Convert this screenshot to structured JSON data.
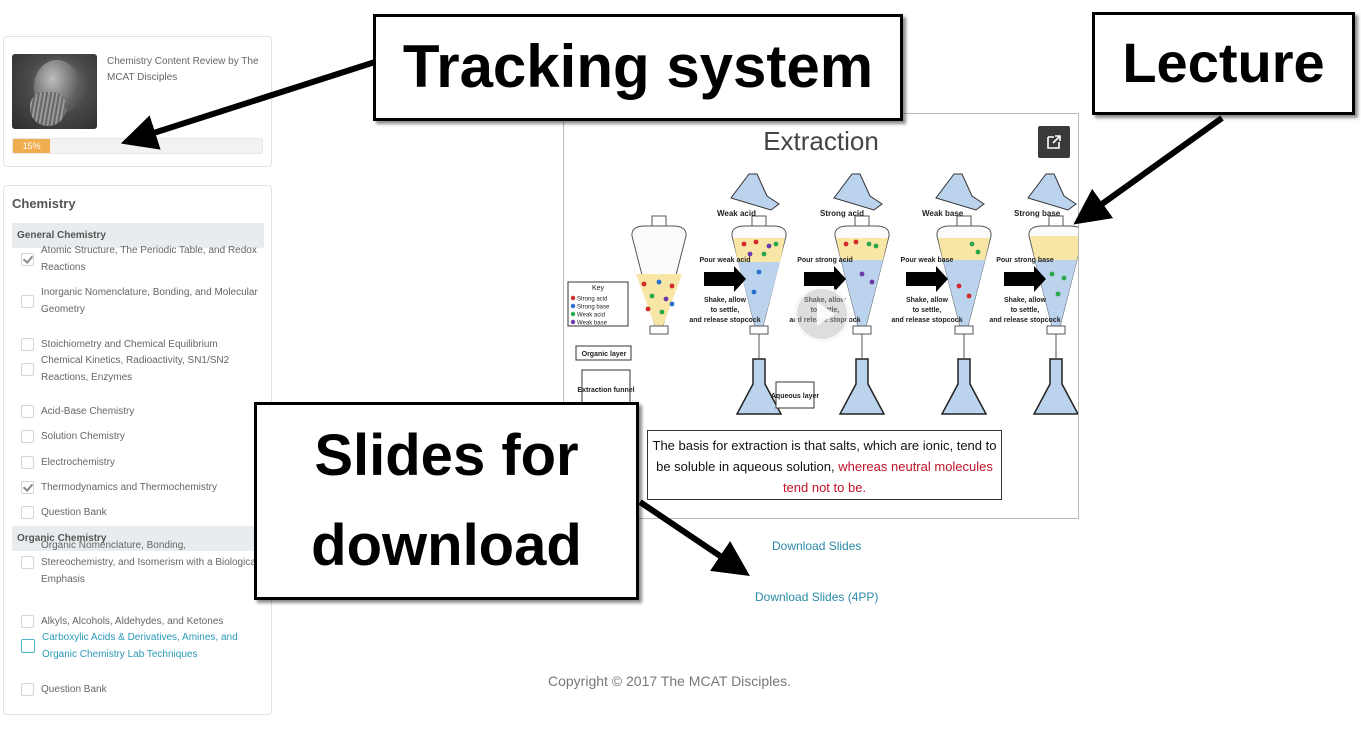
{
  "course": {
    "title": "Chemistry Content Review by The MCAT Disciples",
    "progress_label": "15%",
    "progress_fraction": 0.15,
    "image": "portrait-illustration"
  },
  "curriculum": {
    "title": "Chemistry",
    "sections": [
      {
        "label": "General Chemistry",
        "items": [
          {
            "label": "Atomic Structure, The Periodic Table, and Redox Reactions",
            "checked": true
          },
          {
            "label": "Inorganic Nomenclature, Bonding, and Molecular Geometry",
            "checked": false
          },
          {
            "label": "Stoichiometry and Chemical Equilibrium",
            "checked": false
          },
          {
            "label": "Chemical Kinetics, Radioactivity, SN1/SN2 Reactions, Enzymes",
            "checked": false
          },
          {
            "label": "Acid-Base Chemistry",
            "checked": false
          },
          {
            "label": "Solution Chemistry",
            "checked": false
          },
          {
            "label": "Electrochemistry",
            "checked": false
          },
          {
            "label": "Thermodynamics and Thermochemistry",
            "checked": true
          },
          {
            "label": "Question Bank",
            "checked": false
          }
        ]
      },
      {
        "label": "Organic Chemistry",
        "items": [
          {
            "label": "Organic Nomenclature, Bonding, Stereochemistry, and Isomerism with a Biological Emphasis",
            "checked": false
          },
          {
            "label": "Alkyls, Alcohols, Aldehydes, and Ketones",
            "checked": false
          },
          {
            "label": "Carboxylic Acids & Derivatives, Amines, and Organic Chemistry Lab Techniques",
            "checked": false,
            "active": true
          },
          {
            "label": "Question Bank",
            "checked": false
          }
        ]
      }
    ]
  },
  "lecture": {
    "slide_title": "Extraction",
    "popout_icon": "external-link-icon",
    "play_icon": "play-icon",
    "key": {
      "title": "Key",
      "entries": [
        "Strong acid",
        "Strong base",
        "Weak acid",
        "Weak base"
      ]
    },
    "reagents": [
      "Weak acid",
      "Strong acid",
      "Weak base",
      "Strong base"
    ],
    "steps": [
      {
        "pour": "Pour weak acid",
        "instruction": "Shake, allow to settle, and release stopcock"
      },
      {
        "pour": "Pour strong acid",
        "instruction": "Shake, allow to settle, and release stopcock"
      },
      {
        "pour": "Pour weak base",
        "instruction": "Shake, allow to settle, and release stopcock"
      },
      {
        "pour": "Pour strong base",
        "instruction": "Shake, allow to settle, and release stopcock"
      }
    ],
    "labels": {
      "organic_layer": "Organic layer",
      "funnel": "Extraction separatory funnel",
      "aqueous_layer": "Aqueous layer"
    },
    "caption_black": "The basis for extraction is that salts, which are ionic, tend to be soluble in aqueous solution, ",
    "caption_red": "whereas neutral molecules tend not to be."
  },
  "downloads": {
    "slides": "Download Slides",
    "slides_4pp": "Download Slides (4PP)"
  },
  "footer": {
    "copyright": "Copyright © 2017 The MCAT Disciples."
  },
  "callouts": {
    "tracking": "Tracking system",
    "lecture": "Lecture",
    "slides_line1": "Slides for",
    "slides_line2": "download"
  },
  "colors": {
    "progress": "#f0ad4e",
    "link": "#2a8aa8",
    "active_item": "#2a98b8",
    "caption_red": "#c0142a"
  }
}
